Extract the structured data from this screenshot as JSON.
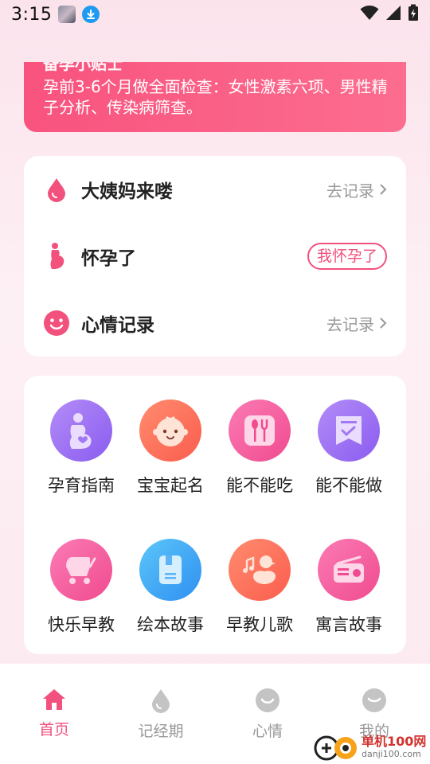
{
  "status_bar": {
    "time": "3:15"
  },
  "tip_card": {
    "title_partial": "备孕小贴士",
    "text": "孕前3-6个月做全面检查：女性激素六项、男性精子分析、传染病筛查。"
  },
  "records": [
    {
      "label": "大姨妈来喽",
      "action": "去记录",
      "icon": "drop-icon"
    },
    {
      "label": "怀孕了",
      "action": "我怀孕了",
      "icon": "pregnant-icon"
    },
    {
      "label": "心情记录",
      "action": "去记录",
      "icon": "smile-icon"
    }
  ],
  "tools": [
    {
      "label": "孕育指南",
      "icon": "pregnancy-guide-icon",
      "color": "#9b6bf2"
    },
    {
      "label": "宝宝起名",
      "icon": "baby-face-icon",
      "color": "#ff6f5b"
    },
    {
      "label": "能不能吃",
      "icon": "cutlery-icon",
      "color": "#f25a9e"
    },
    {
      "label": "能不能做",
      "icon": "checklist-icon",
      "color": "#9b6bf2"
    },
    {
      "label": "快乐早教",
      "icon": "stroller-icon",
      "color": "#f25a9e"
    },
    {
      "label": "绘本故事",
      "icon": "book-icon",
      "color": "#3aa8f2"
    },
    {
      "label": "早教儿歌",
      "icon": "duck-music-icon",
      "color": "#ff6f5b"
    },
    {
      "label": "寓言故事",
      "icon": "radio-icon",
      "color": "#f25a9e"
    }
  ],
  "tabs": [
    {
      "label": "首页",
      "icon": "home-icon",
      "active": true
    },
    {
      "label": "记经期",
      "icon": "drop-icon",
      "active": false
    },
    {
      "label": "心情",
      "icon": "smile-icon",
      "active": false
    },
    {
      "label": "我的",
      "icon": "profile-icon",
      "active": false
    }
  ],
  "watermark": {
    "main": "单机100网",
    "sub": "danji100.com"
  },
  "colors": {
    "accent": "#f2507d",
    "banner": "#f8537e",
    "inactive": "#999999"
  }
}
